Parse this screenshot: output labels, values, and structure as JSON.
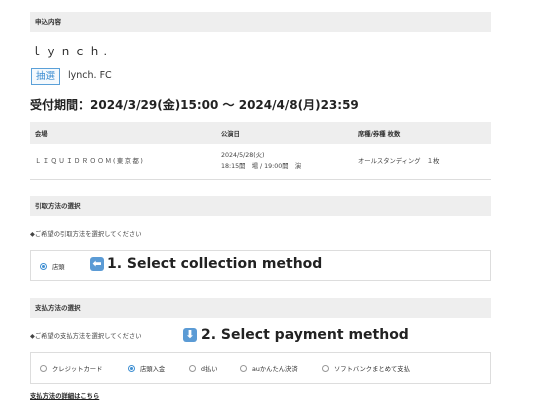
{
  "application": {
    "section_label": "申込内容",
    "artist": "ｌｙｎｃｈ.",
    "lottery_badge": "抽選",
    "fanclub": "lynch. FC",
    "period": "受付期間：2024/3/29(金)15:00 〜 2024/4/8(月)23:59"
  },
  "table": {
    "headers": [
      "会場",
      "公演日",
      "席種/券種 枚数"
    ],
    "row": {
      "venue": "ＬＩＱＵＩＤＲＯＯＭ(東京都)",
      "date_line1": "2024/5/28(火)",
      "date_line2": "18:15開　場 / 19:00開　演",
      "seat": "オールスタンディング　１枚"
    }
  },
  "collection": {
    "section_label": "引取方法の選択",
    "note": "◆ご希望の引取方法を選択してください",
    "option": "店頭",
    "selected": "店頭"
  },
  "payment": {
    "section_label": "支払方法の選択",
    "note": "◆ご希望の支払方法を選択してください",
    "options": [
      "クレジットカード",
      "店頭入金",
      "d払い",
      "auかんたん決済",
      "ソフトバンクまとめて支払"
    ],
    "selected": "店頭入金",
    "details_link": "支払方法の詳細はこちら"
  },
  "annotations": {
    "collection": "1. Select collection method",
    "collection_icon": "left-arrow-icon",
    "payment": "2. Select payment method",
    "payment_icon": "down-arrow-icon",
    "icon_color": "#5b9bd5"
  },
  "colors": {
    "accent": "#3f8fd2",
    "section_bg": "#eeeeee"
  }
}
